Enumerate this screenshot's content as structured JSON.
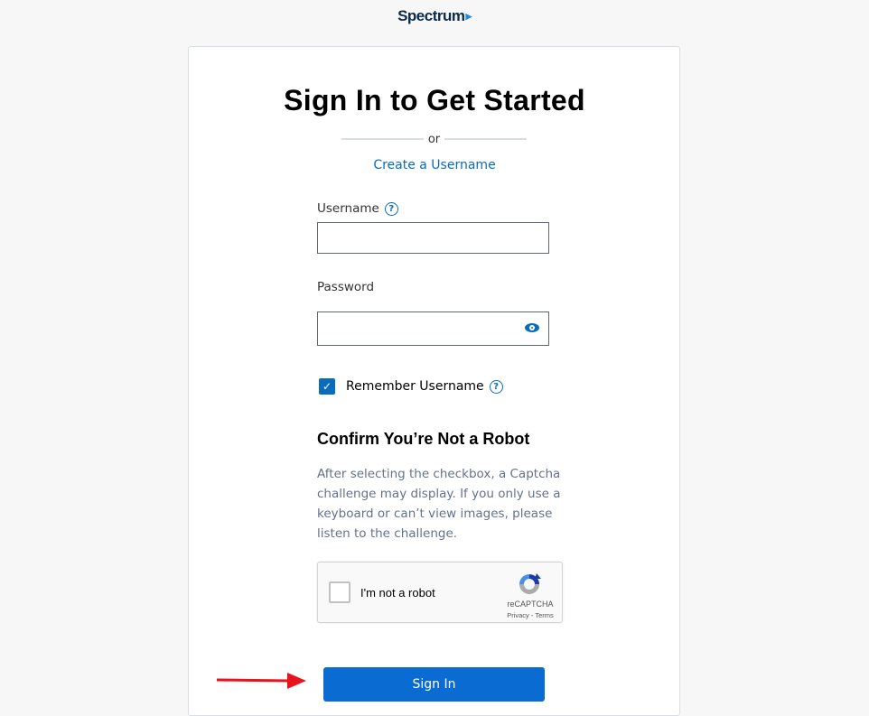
{
  "header": {
    "logo_text": "Spectrum",
    "logo_mark": "▶"
  },
  "card": {
    "title": "Sign In to Get Started",
    "divider_text": "or",
    "create_username_link": "Create a Username",
    "username": {
      "label": "Username",
      "help_icon": "?",
      "value": "",
      "placeholder": ""
    },
    "password": {
      "label": "Password",
      "value": "",
      "placeholder": "",
      "toggle_icon": "eye-icon"
    },
    "remember": {
      "checked": true,
      "check_glyph": "✓",
      "label": "Remember Username",
      "help_icon": "?"
    },
    "robot": {
      "heading": "Confirm You’re Not a Robot",
      "description": "After selecting the checkbox, a Captcha challenge may display. If you only use a keyboard or can’t view images, please listen to the challenge."
    },
    "recaptcha": {
      "checkbox_label": "I'm not a robot",
      "brand": "reCAPTCHA",
      "links": "Privacy - Terms"
    },
    "signin_button": "Sign In"
  },
  "colors": {
    "accent": "#0a6cd2",
    "link": "#0a6cbd",
    "annotation_arrow": "#e8141b"
  }
}
